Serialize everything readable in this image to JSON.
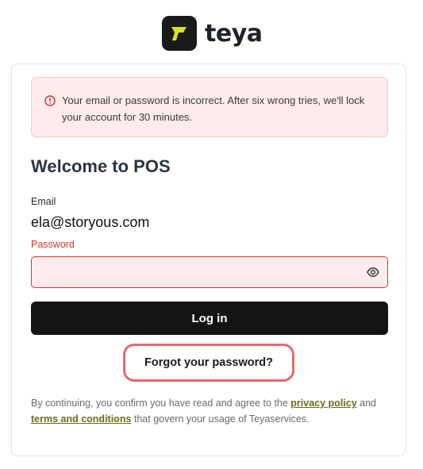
{
  "brand": {
    "name": "teya",
    "accent": "#d6e22b"
  },
  "alert": {
    "message": "Your email or password is incorrect. After six wrong tries, we'll lock your account for 30 minutes.",
    "icon": "info-circle-icon",
    "color": "#d0342c"
  },
  "form": {
    "title": "Welcome to POS",
    "email_label": "Email",
    "email_value": "ela@storyous.com",
    "password_label": "Password",
    "password_value": "",
    "show_password_icon": "eye-icon",
    "login_label": "Log in",
    "forgot_label": "Forgot your password?"
  },
  "legal": {
    "prefix": "By continuing, you confirm you have read and agree to the ",
    "privacy_link": "privacy policy",
    "and": " and ",
    "terms_link": "terms and conditions",
    "suffix": " that govern your usage of Teyaservices."
  }
}
